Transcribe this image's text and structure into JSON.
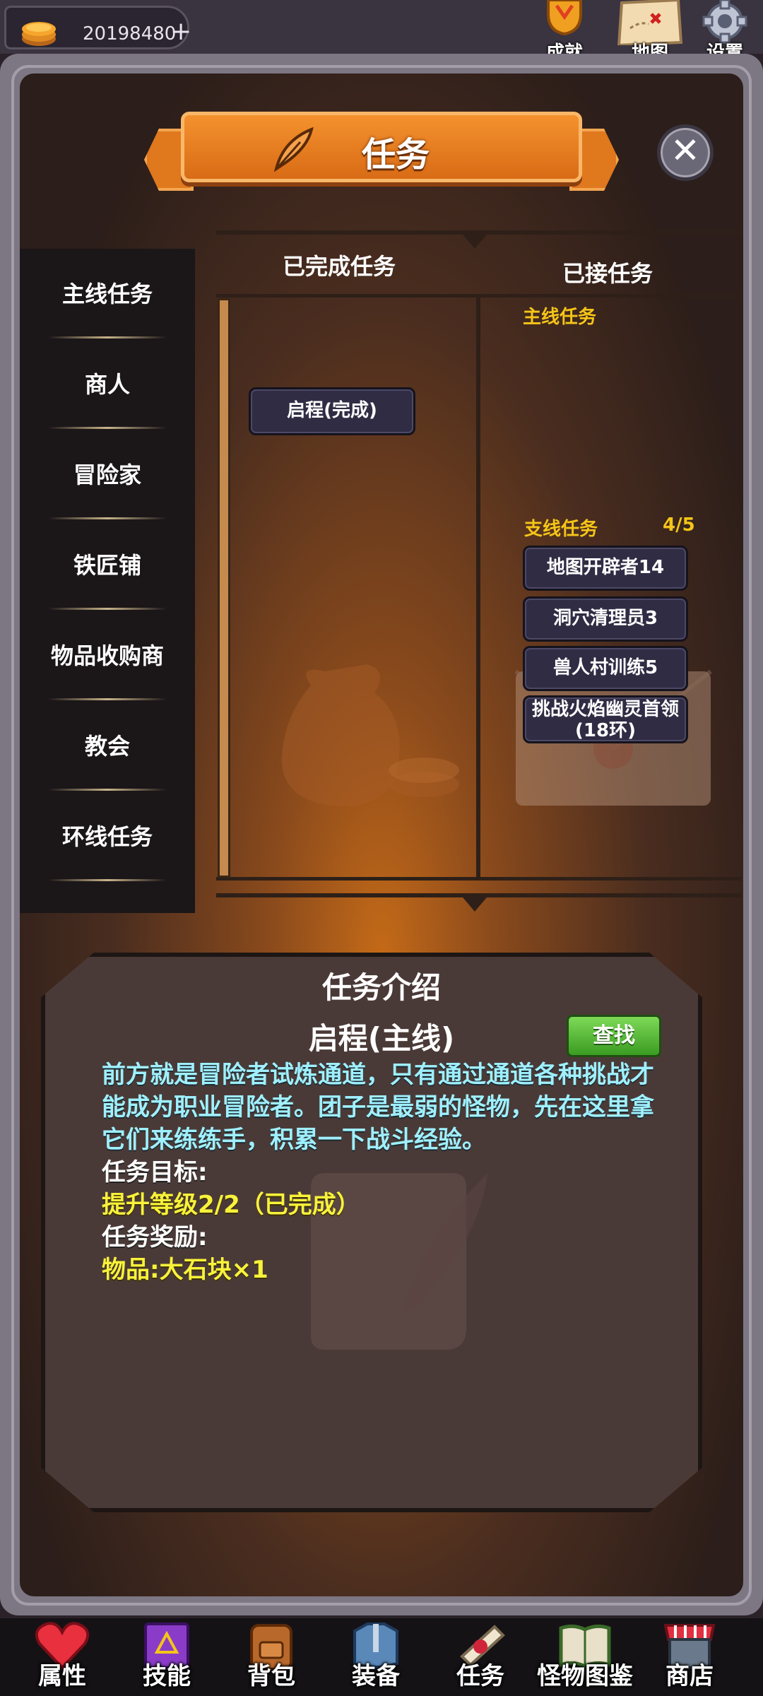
{
  "top": {
    "coins": "20198480",
    "plus": "+",
    "icons": [
      {
        "label": "成就",
        "icon": "trophy-icon"
      },
      {
        "label": "地图",
        "icon": "map-icon"
      },
      {
        "label": "设置",
        "icon": "gear-icon"
      }
    ]
  },
  "panel": {
    "title": "任务",
    "close": "✕"
  },
  "left_menu": [
    "主线任务",
    "商人",
    "冒险家",
    "铁匠铺",
    "物品收购商",
    "教会",
    "环线任务"
  ],
  "columns": {
    "completed_head": "已完成任务",
    "accepted_head": "已接任务"
  },
  "completed_tasks": [
    "启程(完成)"
  ],
  "accepted": {
    "main_head": "主线任务",
    "side_head": "支线任务",
    "side_count": "4/5",
    "side_tasks": [
      "地图开辟者14",
      "洞穴清理员3",
      "兽人村训练5",
      "挑战火焰幽灵首领(18环)"
    ]
  },
  "intro": {
    "title": "任务介绍",
    "name": "启程(主线)",
    "find_button": "查找",
    "description": "前方就是冒险者试炼通道，只有通过通道各种挑战才能成为职业冒险者。团子是最弱的怪物，先在这里拿它们来练练手，积累一下战斗经验。",
    "goal_label": "任务目标:",
    "goal_value": "提升等级2/2（已完成）",
    "reward_label": "任务奖励:",
    "reward_value": "物品:大石块×1"
  },
  "bottom_nav": [
    {
      "label": "属性",
      "icon": "heart-icon"
    },
    {
      "label": "技能",
      "icon": "spellbook-icon"
    },
    {
      "label": "背包",
      "icon": "backpack-icon"
    },
    {
      "label": "装备",
      "icon": "armor-icon"
    },
    {
      "label": "任务",
      "icon": "quest-scroll-icon"
    },
    {
      "label": "怪物图鉴",
      "icon": "monster-book-icon"
    },
    {
      "label": "商店",
      "icon": "shop-icon"
    }
  ],
  "colors": {
    "banner": "#e0781e",
    "text_cyan": "#9ff0ff",
    "text_yellow": "#f8f23a",
    "sub_head_yellow": "#f5c518",
    "find_green": "#4caf2a"
  }
}
